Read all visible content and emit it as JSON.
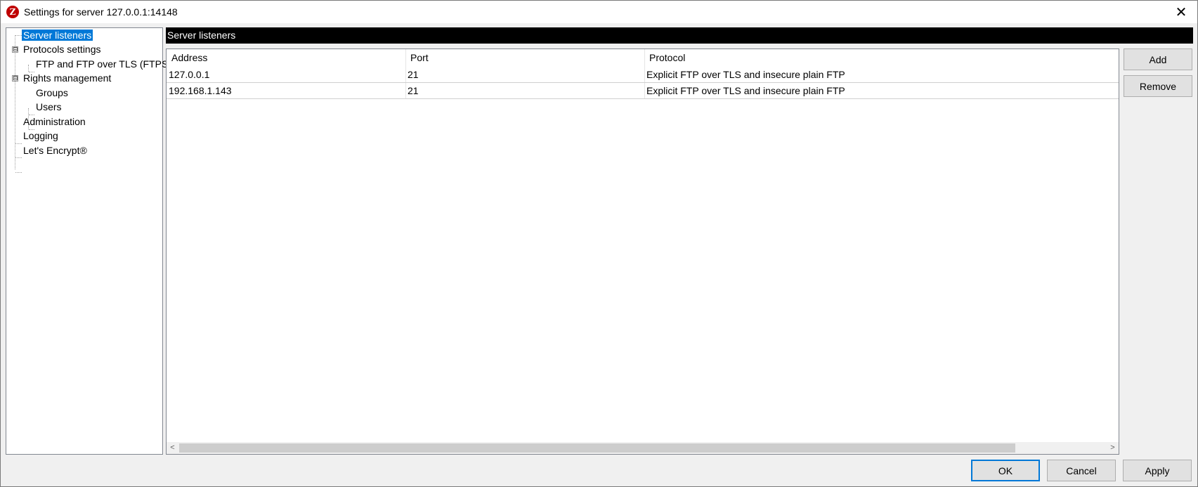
{
  "window": {
    "title": "Settings for server 127.0.0.1:14148",
    "icon_glyph": "Z",
    "close_glyph": "✕"
  },
  "tree": {
    "items": [
      {
        "label": "Server listeners"
      },
      {
        "label": "Protocols settings",
        "expander": "⊟"
      },
      {
        "label": "FTP and FTP over TLS (FTPS)"
      },
      {
        "label": "Rights management",
        "expander": "⊟"
      },
      {
        "label": "Groups"
      },
      {
        "label": "Users"
      },
      {
        "label": "Administration"
      },
      {
        "label": "Logging"
      },
      {
        "label": "Let's Encrypt®"
      }
    ]
  },
  "section": {
    "title": "Server listeners"
  },
  "listeners": {
    "columns": [
      "Address",
      "Port",
      "Protocol"
    ],
    "rows": [
      {
        "address": "127.0.0.1",
        "port": "21",
        "protocol": "Explicit FTP over TLS and insecure plain FTP"
      },
      {
        "address": "192.168.1.143",
        "port": "21",
        "protocol": "Explicit FTP over TLS and insecure plain FTP"
      }
    ],
    "scroll_left": "<",
    "scroll_right": ">"
  },
  "side_buttons": {
    "add": "Add",
    "remove": "Remove"
  },
  "footer": {
    "ok": "OK",
    "cancel": "Cancel",
    "apply": "Apply"
  }
}
